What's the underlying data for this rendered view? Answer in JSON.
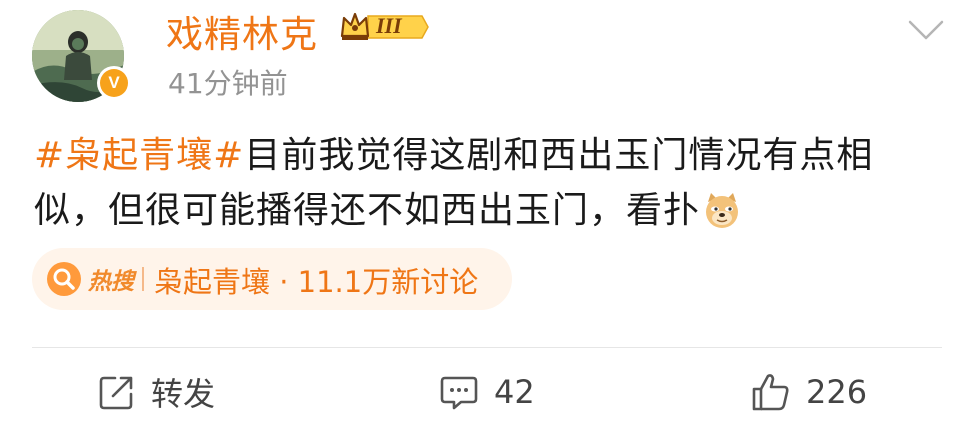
{
  "post": {
    "username": "戏精林克",
    "member_badge": "III",
    "time": "41分钟前",
    "verified_badge": "V",
    "hashtag": "#枭起青壤#",
    "text": "目前我觉得这剧和西出玉门情况有点相似，但很可能播得还不如西出玉门，看扑",
    "emoji": "doge-emoji"
  },
  "hot_topic": {
    "label": "热搜",
    "text": "枭起青壤 · 11.1万新讨论"
  },
  "actions": {
    "repost_label": "转发",
    "comment_count": "42",
    "like_count": "226"
  },
  "colors": {
    "accent": "#ef7616",
    "chip_bg": "#fff4ea",
    "muted": "#939393",
    "text": "#1a1a1a"
  },
  "icons": [
    "chevron-down-icon",
    "crown-icon",
    "hot-search-icon",
    "repost-icon",
    "comment-icon",
    "like-icon"
  ]
}
